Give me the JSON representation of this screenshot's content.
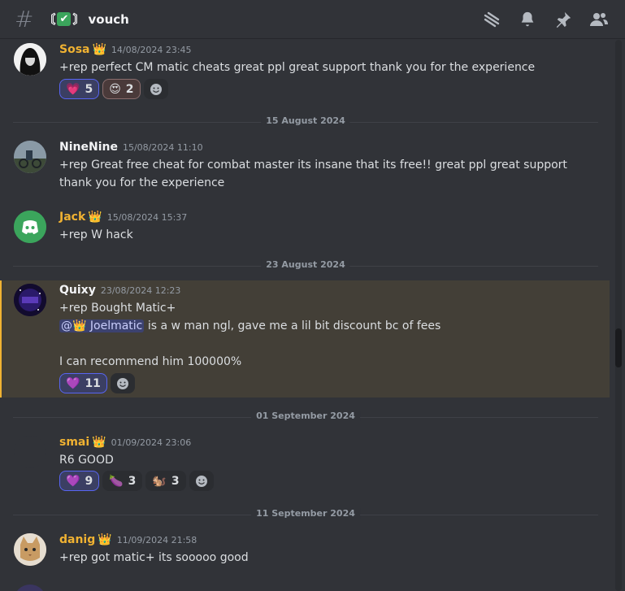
{
  "header": {
    "channel_prefix": "〘",
    "channel_suffix": "〙",
    "channel_check": "✔",
    "channel_name": "vouch",
    "icons": [
      "threads-icon",
      "bell-icon",
      "pin-icon",
      "members-icon"
    ]
  },
  "messages": [
    {
      "author": "Sosa",
      "crown": "👑",
      "timestamp": "14/08/2024 23:45",
      "lines": [
        "+rep perfect CM matic cheats great ppl great support thank you for the experience"
      ],
      "reactions": [
        {
          "emoji": "💗",
          "count": "5"
        },
        {
          "emoji": "😍",
          "count": "2"
        }
      ]
    },
    {
      "author": "NineNine",
      "timestamp": "15/08/2024 11:10",
      "lines": [
        "+rep Great free cheat for combat master its insane that its free!! great ppl great support",
        "thank you for the experience"
      ]
    },
    {
      "author": "Jack",
      "crown": "👑",
      "timestamp": "15/08/2024 15:37",
      "lines": [
        "+rep W hack"
      ]
    },
    {
      "author": "Quixy",
      "timestamp": "23/08/2024 12:23",
      "lines": [
        "+rep Bought Matic+",
        "is a w man ngl, gave me a lil bit discount bc of fees",
        "I can recommend him 100000%"
      ],
      "mention": "@👑 Joelmatic",
      "reactions": [
        {
          "emoji": "💜",
          "count": "11"
        }
      ]
    },
    {
      "author": "smai",
      "crown": "👑",
      "timestamp": "01/09/2024 23:06",
      "lines": [
        "R6 GOOD"
      ],
      "reactions": [
        {
          "emoji": "💜",
          "count": "9"
        },
        {
          "emoji": "🍆",
          "count": "3"
        },
        {
          "emoji": "🐿️",
          "count": "3"
        }
      ]
    },
    {
      "author": "danig",
      "crown": "👑",
      "timestamp": "11/09/2024 21:58",
      "lines": [
        "+rep got matic+ its sooooo good"
      ]
    }
  ],
  "dividers": [
    "15 August 2024",
    "23 August 2024",
    "01 September 2024",
    "11 September 2024"
  ],
  "colors": {
    "background": "#313338",
    "highlight": "#433f37",
    "highlight_border": "#f0b232",
    "role_gold": "#f0b232",
    "blurple": "#5865f2"
  }
}
